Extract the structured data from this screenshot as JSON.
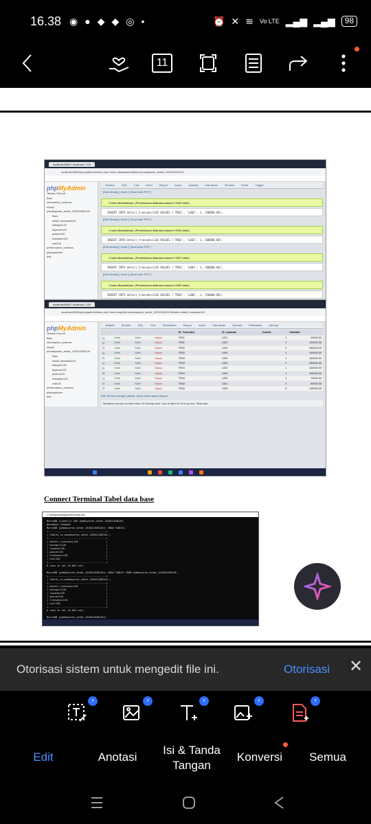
{
  "status_bar": {
    "time": "16.38",
    "network": "Vo LTE",
    "battery": "98"
  },
  "toolbar": {
    "page_count": "11",
    "icons": [
      "back-icon",
      "donate-icon",
      "page-count-icon",
      "fullscreen-icon",
      "read-mode-icon",
      "share-icon",
      "more-icon"
    ]
  },
  "document": {
    "screenshot1": {
      "browser_tab": "localhost:8080 / localhost / 120",
      "url": "localhost:8080/phpmyadmin/index.php?route=/database/sql&db=pembayaran_sehat_102022400120",
      "logo_main": "php",
      "logo_accent": "MyAdmin",
      "sidebar": [
        "Terbaru  Favorit",
        "Baru",
        "information_schema",
        "mysql",
        "pembayaran_sehat_102022400120",
        "Baru",
        "detail_transaksi120",
        "kategori120",
        "layanan120",
        "pasien120",
        "transaksi120",
        "unit120",
        "performance_schema",
        "phpmyadmin",
        "test"
      ],
      "nav": [
        "Struktur",
        "SQL",
        "Cari",
        "Kueri",
        "Ekspor",
        "Impor",
        "Operasi",
        "Hak Akses",
        "Routine",
        "Event",
        "Trigger"
      ],
      "edit_link": "[Edit dibaris] [ Ubah ] [ Buat kode PHP ]",
      "messages": [
        {
          "ok": "1 baris ditambahkan. (Pemeriksaan dilakukan dalam 0.0043 detik.)",
          "sql": "INSERT INTO detail_transaksi120 VALUES ('TR01', 'L002', 1, 140000.00);"
        },
        {
          "ok": "1 baris ditambahkan. (Pemeriksaan dilakukan dalam 0.0004 detik.)",
          "sql": "INSERT INTO detail_transaksi120 VALUES ('TR02', 'L002', 1, 100000.00);"
        },
        {
          "ok": "1 baris ditambahkan. (Pemeriksaan dilakukan dalam 0.0007 detik.)",
          "sql": "INSERT INTO detail_transaksi120 VALUES ('TR03', 'L003', 1, 100000.00);"
        },
        {
          "ok": "1 baris ditambahkan. (Pemeriksaan dilakukan dalam 0.0005 detik.)",
          "sql": "INSERT INTO detail_transaksi120 VALUES ('TR04', 'L004', 1, 150000.00);"
        }
      ]
    },
    "screenshot2": {
      "browser_tab": "localhost:8080 / localhost / 120",
      "url": "localhost:8080/phpmyadmin/index.php?route=/sql&db=pembayaran_sehat_102022400120&table=detail_transaksi120",
      "nav": [
        "Jelajahi",
        "Struktur",
        "SQL",
        "Cari",
        "Tambahkan",
        "Ekspor",
        "Impor",
        "Hak Akses",
        "Operasi",
        "Pelacakan",
        "Lainnya"
      ],
      "columns": [
        "",
        "",
        "ID_Transaksi",
        "ID_Layanan",
        "Jumlah",
        "Subtotal"
      ],
      "rows": [
        [
          "Ubah",
          "Salin",
          "Hapus",
          "TR01",
          "L001",
          "2",
          "40000.00"
        ],
        [
          "Ubah",
          "Salin",
          "Hapus",
          "TR01",
          "L002",
          "1",
          "140000.00"
        ],
        [
          "Ubah",
          "Salin",
          "Hapus",
          "TR02",
          "L002",
          "2",
          "280000.00"
        ],
        [
          "Ubah",
          "Salin",
          "Hapus",
          "TR02",
          "L004",
          "1",
          "100000.00"
        ],
        [
          "Ubah",
          "Salin",
          "Hapus",
          "TR03",
          "L003",
          "1",
          "150000.00"
        ],
        [
          "Ubah",
          "Salin",
          "Hapus",
          "TR03",
          "L003",
          "1",
          "250000.00"
        ],
        [
          "Ubah",
          "Salin",
          "Hapus",
          "TR04",
          "L002",
          "1",
          "140000.00"
        ],
        [
          "Ubah",
          "Salin",
          "Hapus",
          "TR04",
          "L004",
          "1",
          "100000.00"
        ],
        [
          "Ubah",
          "Salin",
          "Hapus",
          "TR04",
          "L006",
          "2",
          "70000.00"
        ],
        [
          "Ubah",
          "Salin",
          "Hapus",
          "TR05",
          "L001",
          "3",
          "60000.00"
        ],
        [
          "Ubah",
          "Salin",
          "Hapus",
          "TR05",
          "L005",
          "3",
          "105000.00"
        ]
      ],
      "footer": "Pilih Semua    Dengan pilihan:  Ubah  Salin  Hapus  Ekspor",
      "footer2": "Tampilkan semua   Jumlah baris: 25   Saring baris: Cari di tabel ini   Sort by key: Tidak ada"
    },
    "caption": "Connect Terminal Tabel data base",
    "terminal": {
      "title": "C:\\Windows\\system32\\cmd.exe",
      "lines": "MariaDB [(none)]> USE pembayaran_sehat_102022400120;\nDatabase changed\nMariaDB [pembayaran_sehat_102022400120]> SHOW TABLES;\n+---------------------------------------+\n| Tables_in_pembayaran_sehat_102022400120 |\n+---------------------------------------+\n| detail_transaksi120                   |\n| kategori120                           |\n| layanan120                            |\n| pasien120                             |\n| transaksi120                          |\n| unit120                               |\n+---------------------------------------+\n6 rows in set (0.001 sec)\n\nMariaDB [pembayaran_sehat_102022400120]> SHOW TABLES FROM pembayaran_sehat_102022400120;\n+---------------------------------------+\n| Tables_in_pembayaran_sehat_102022400120 |\n+---------------------------------------+\n| detail_transaksi120                   |\n| kategori120                           |\n| layanan120                            |\n| pasien120                             |\n| transaksi120                          |\n| unit120                               |\n+---------------------------------------+\n6 rows in set (0.001 sec)\n\nMariaDB [pembayaran_sehat_102022400120]>"
    }
  },
  "banner": {
    "message": "Otorisasi sistem untuk mengedit file ini.",
    "action": "Otorisasi"
  },
  "bottom_tools": [
    {
      "label": "Edit",
      "icon": "edit-text-icon"
    },
    {
      "label": "Anotasi",
      "icon": "annotate-image-icon"
    },
    {
      "label": "Isi & Tanda\nTangan",
      "icon": "text-add-icon"
    },
    {
      "label": "Konversi",
      "icon": "convert-image-icon"
    },
    {
      "label": "Semua",
      "icon": "pdf-add-icon"
    }
  ],
  "badge_glyph": "⚡",
  "colors": {
    "accent_blue": "#4a90ff",
    "badge_blue": "#2d6bff",
    "notify_red": "#ff5a3c"
  }
}
